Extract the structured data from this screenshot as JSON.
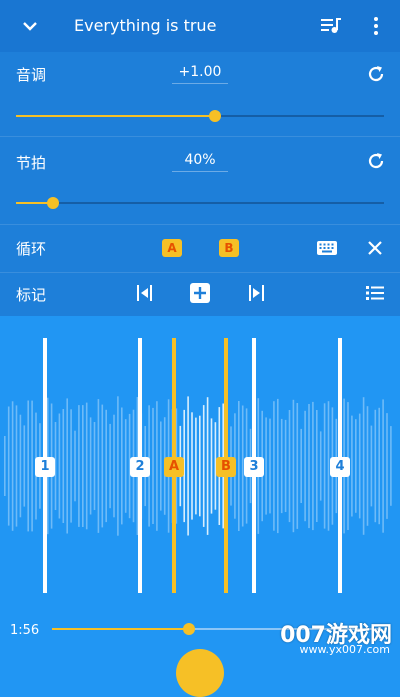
{
  "header": {
    "title": "Everything is true",
    "collapse_icon": "chevron-down-icon",
    "playlist_icon": "playlist-music-icon",
    "menu_icon": "more-vert-icon"
  },
  "pitch": {
    "label": "音调",
    "value": "+1.00",
    "level_fraction": 0.54,
    "reset_icon": "refresh-icon"
  },
  "tempo": {
    "label": "节拍",
    "value": "40%",
    "level_fraction": 0.1,
    "reset_icon": "refresh-icon"
  },
  "loop": {
    "label": "循环",
    "point_a": "A",
    "point_b": "B",
    "keyboard_icon": "keyboard-icon",
    "close_icon": "close-icon"
  },
  "marks": {
    "label": "标记",
    "prev_icon": "marker-previous-icon",
    "add_icon": "add-marker-icon",
    "next_icon": "marker-next-icon",
    "list_icon": "marker-list-icon"
  },
  "waveform": {
    "markers": [
      {
        "label": "1"
      },
      {
        "label": "2"
      },
      {
        "label": "A"
      },
      {
        "label": "B"
      },
      {
        "label": "3"
      },
      {
        "label": "4"
      }
    ]
  },
  "playback": {
    "current_time": "1:56",
    "progress_fraction": 0.42
  },
  "watermark": {
    "brand": "007游戏网",
    "url": "www.yx007.com"
  },
  "colors": {
    "accent": "#f6c026",
    "primary": "#2196f3",
    "header": "#1976d2",
    "panel": "#1e7fd9"
  }
}
